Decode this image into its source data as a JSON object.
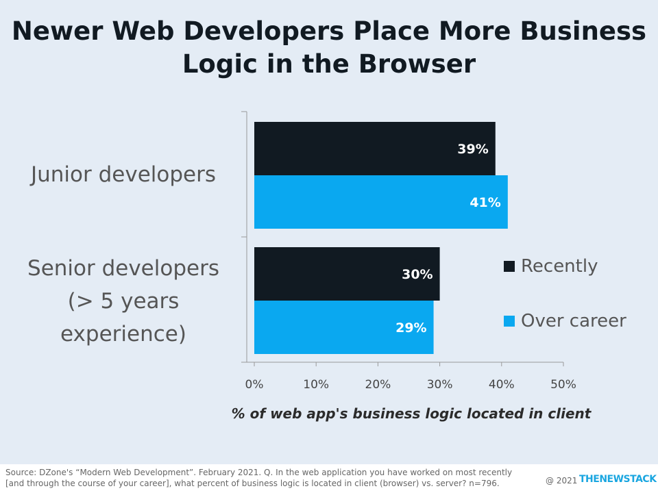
{
  "title": "Newer Web Developers Place More Business Logic in the Browser",
  "chart_data": {
    "type": "bar",
    "orientation": "horizontal",
    "categories": [
      "Junior developers",
      "Senior developers (> 5 years experience)"
    ],
    "series": [
      {
        "name": "Recently",
        "color": "#111a22",
        "values": [
          39,
          30
        ],
        "labels": [
          "39%",
          "30%"
        ]
      },
      {
        "name": "Over career",
        "color": "#0aa8f0",
        "values": [
          41,
          29
        ],
        "labels": [
          "41%",
          "29%"
        ]
      }
    ],
    "xlabel": "% of web app's business logic located in client",
    "xlim": [
      0,
      50
    ],
    "xticks": [
      "0%",
      "10%",
      "20%",
      "30%",
      "40%",
      "50%"
    ],
    "legend_position": "right",
    "grid": false
  },
  "footer": {
    "source": "Source: DZone's “Modern Web Development”. February 2021. Q.  In the web application you have worked on most recently [and through the course of your career], what percent of business logic is located in client (browser) vs. server? n=796.",
    "copyright": "@ 2021",
    "brand": "THENEWSTACK"
  }
}
